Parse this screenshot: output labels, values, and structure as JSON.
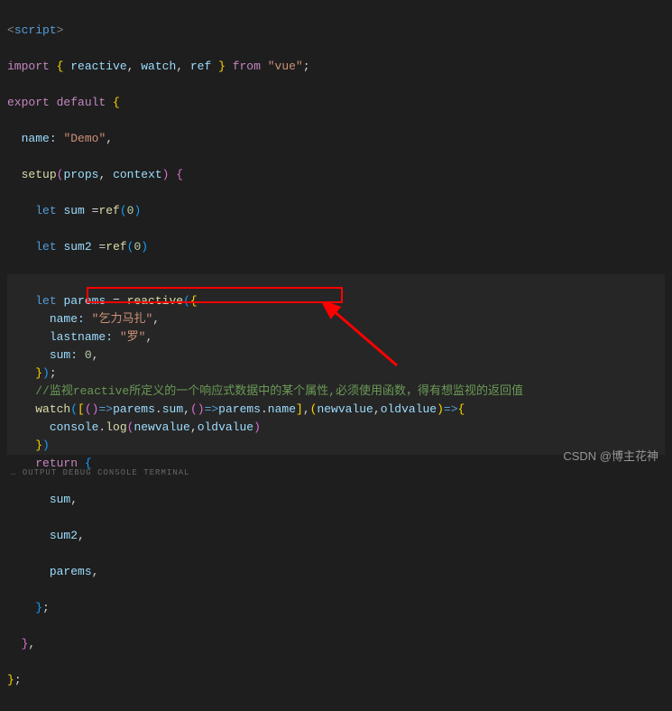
{
  "code": {
    "l1": {
      "t1": "<",
      "t2": "script",
      "t3": ">"
    },
    "l2": {
      "t1": "import",
      "t2": " { ",
      "t3": "reactive",
      "t4": ", ",
      "t5": "watch",
      "t6": ", ",
      "t7": "ref",
      "t8": " } ",
      "t9": "from",
      "t10": " ",
      "t11": "\"vue\"",
      "t12": ";"
    },
    "l3": {
      "t1": "export",
      "t2": " ",
      "t3": "default",
      "t4": " {"
    },
    "l4": {
      "pad": "  ",
      "t1": "name:",
      "t2": " ",
      "t3": "\"Demo\"",
      "t4": ","
    },
    "l5": {
      "pad": "  ",
      "t1": "setup",
      "t2": "(",
      "t3": "props",
      "t4": ", ",
      "t5": "context",
      "t6": ")",
      "t7": " {"
    },
    "l6": {
      "pad": "    ",
      "t1": "let",
      "t2": " ",
      "t3": "sum",
      "t4": " =",
      "t5": "ref",
      "t6": "(",
      "t7": "0",
      "t8": ")"
    },
    "l7": {
      "pad": "    ",
      "t1": "let",
      "t2": " ",
      "t3": "sum2",
      "t4": " =",
      "t5": "ref",
      "t6": "(",
      "t7": "0",
      "t8": ")"
    },
    "l8": {
      "pad": "    "
    },
    "l9": {
      "pad": "    ",
      "t1": "let",
      "t2": " ",
      "t3": "parems",
      "t4": " = ",
      "t5": "reactive",
      "t6": "(",
      "t7": "{"
    },
    "l10": {
      "pad": "      ",
      "t1": "name:",
      "t2": " ",
      "t3": "\"乞力马扎\"",
      "t4": ","
    },
    "l11": {
      "pad": "      ",
      "t1": "lastname:",
      "t2": " ",
      "t3": "\"罗\"",
      "t4": ","
    },
    "l12": {
      "pad": "      ",
      "t1": "sum:",
      "t2": " ",
      "t3": "0",
      "t4": ","
    },
    "l13": {
      "pad": "    ",
      "t1": "}",
      "t2": ")",
      "t3": ";"
    },
    "l14": {
      "pad": "    ",
      "t1": "//监视reactive所定义的一个响应式数据中的某个属性,必须使用函数，得有想监视的返回值"
    },
    "l15": {
      "pad": "    ",
      "t1": "watch",
      "t2": "(",
      "t3": "[",
      "t4": "(",
      "t5": ")",
      "t6": "=>",
      "t7": "parems",
      "t8": ".",
      "t9": "sum",
      "t10": ",",
      "t11": "(",
      "t12": ")",
      "t13": "=>",
      "t14": "parems",
      "t15": ".",
      "t16": "name",
      "t17": "]",
      "t18": ",",
      "t19": "(",
      "t20": "newvalue",
      "t21": ",",
      "t22": "oldvalue",
      "t23": ")",
      "t24": "=>",
      "t25": "{"
    },
    "l16": {
      "pad": "      ",
      "t1": "console",
      "t2": ".",
      "t3": "log",
      "t4": "(",
      "t5": "newvalue",
      "t6": ",",
      "t7": "oldvalue",
      "t8": ")"
    },
    "l17": {
      "pad": "    ",
      "t1": "}",
      "t2": ")"
    },
    "l18": {
      "pad": "    ",
      "t1": "return",
      "t2": " {"
    },
    "l19": {
      "pad": "      ",
      "t1": "sum",
      "t2": ","
    },
    "l20": {
      "pad": "      ",
      "t1": "sum2",
      "t2": ","
    },
    "l21": {
      "pad": "      ",
      "t1": "parems",
      "t2": ","
    },
    "l22": {
      "pad": "    ",
      "t1": "}",
      "t2": ";"
    },
    "l23": {
      "pad": "  ",
      "t1": "}",
      "t2": ","
    },
    "l24": {
      "t1": "}",
      "t2": ";"
    }
  },
  "watermark": "CSDN @博主花神",
  "bottom": "… OUTPUT   DEBUG CONSOLE   TERMINAL"
}
